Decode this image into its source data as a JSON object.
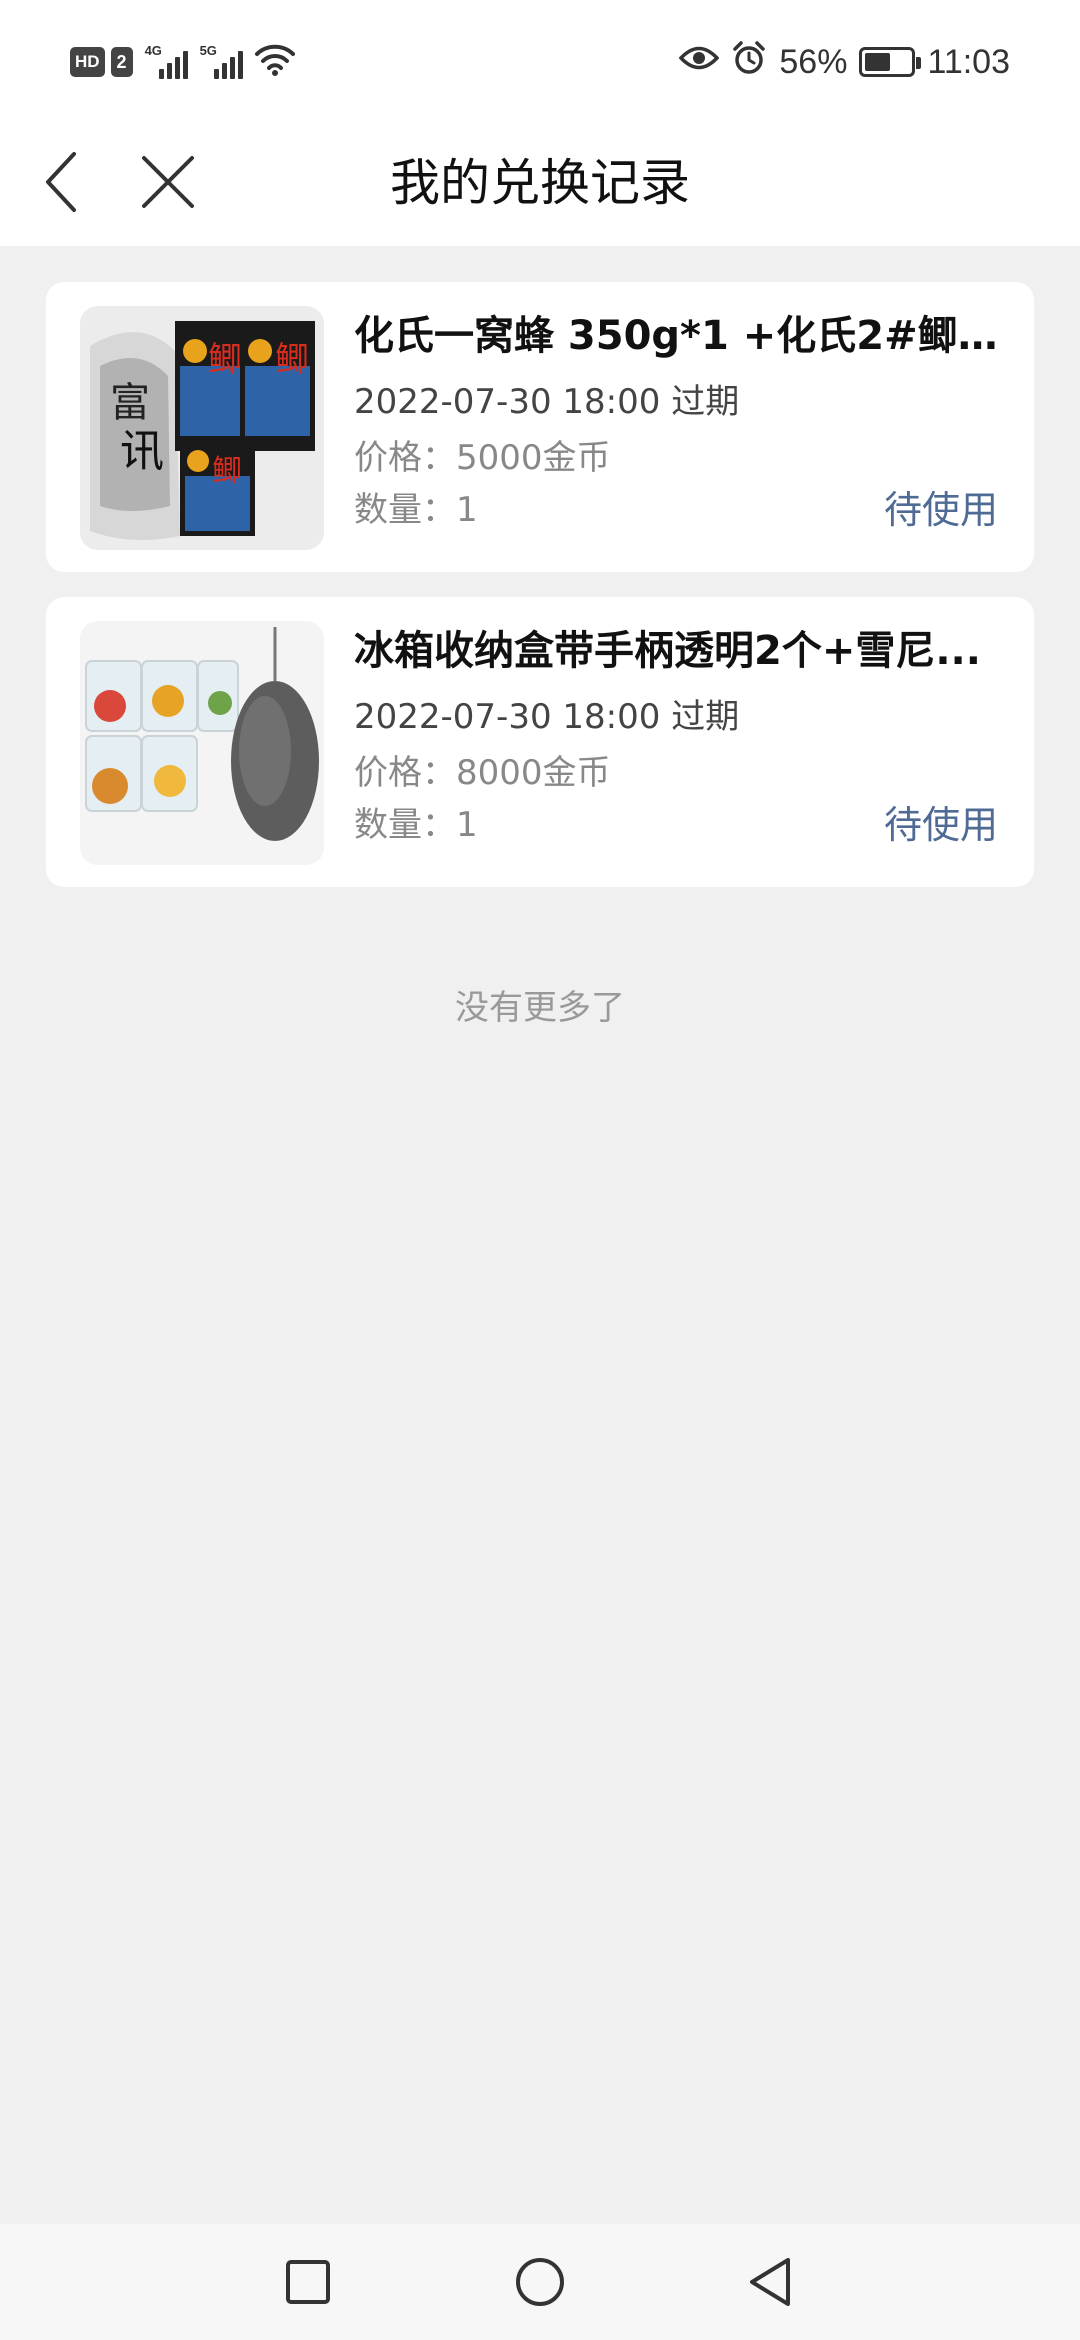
{
  "status_bar": {
    "hd_label": "HD",
    "hd_num": "2",
    "sim1_gen": "4G",
    "sim2_gen": "5G",
    "battery_text": "56%",
    "battery_level": 0.56,
    "time": "11:03"
  },
  "header": {
    "title": "我的兑换记录"
  },
  "records": [
    {
      "name": "化氏一窝蜂 350g*1 +化氏2#鲫...",
      "expiry": "2022-07-30 18:00 过期",
      "price": "价格：5000金币",
      "quantity": "数量：1",
      "status": "待使用"
    },
    {
      "name": "冰箱收纳盒带手柄透明2个+雪尼...",
      "expiry": "2022-07-30 18:00 过期",
      "price": "价格：8000金币",
      "quantity": "数量：1",
      "status": "待使用"
    }
  ],
  "footer": {
    "no_more": "没有更多了"
  },
  "colors": {
    "status": "#4f6a94",
    "background": "#f0f0f0"
  }
}
